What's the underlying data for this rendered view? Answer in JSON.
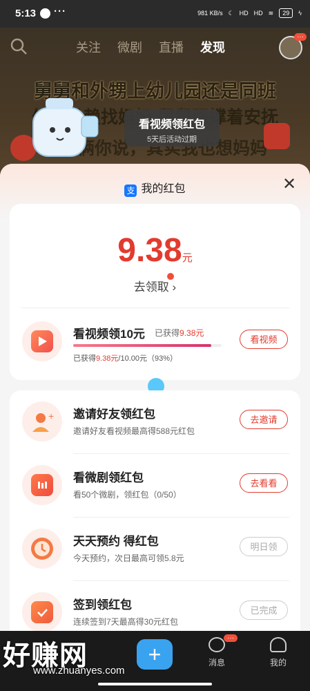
{
  "status": {
    "time": "5:13",
    "dots": "···",
    "speed": "981 KB/s",
    "signal1": "HD",
    "signal2": "HD",
    "battery": "29"
  },
  "nav": {
    "tabs": [
      "关注",
      "微剧",
      "直播",
      "发现"
    ],
    "active": "发现",
    "avatar_badge": "···"
  },
  "video": {
    "title1": "舅舅和外甥上幼儿园还是同班",
    "title2": "外甥没赖找妈妈 舅舅强撑着安抚",
    "title3": "舅舅俩你说，其实我也想妈妈"
  },
  "tooltip": {
    "title": "看视频领红包",
    "subtitle": "5天后活动过期"
  },
  "panel": {
    "header": "我的红包",
    "alipay_icon": "支",
    "amount": "9.38",
    "unit": "元",
    "claim": "去领取 ›",
    "watch_task": {
      "title": "看视频领10元",
      "got_prefix": "已获得",
      "got_value": "9.38元",
      "progress_pct": 93,
      "sub_prefix": "已获得",
      "sub_value": "9.38元",
      "sub_suffix": "/10.00元（93%）",
      "button": "看视频"
    },
    "tasks": [
      {
        "title": "邀请好友领红包",
        "sub": "邀请好友看视频最高得588元红包",
        "button": "去邀请",
        "enabled": true,
        "icon": "invite-friend-icon"
      },
      {
        "title": "看微剧领红包",
        "sub": "看50个微剧，领红包（0/50）",
        "button": "去看看",
        "enabled": true,
        "icon": "tv-icon"
      },
      {
        "title": "天天预约 得红包",
        "sub": "今天预约，次日最高可领5.8元",
        "button": "明日领",
        "enabled": false,
        "icon": "clock-icon"
      },
      {
        "title": "签到领红包",
        "sub": "连续签到7天最高得30元红包",
        "button": "已完成",
        "enabled": false,
        "icon": "calendar-check-icon"
      }
    ]
  },
  "bottom": {
    "plus": "+",
    "messages": "消息",
    "mine": "我的",
    "msg_badge": "···"
  },
  "watermark": {
    "text": "好赚网",
    "url": "www.zhuanyes.com"
  },
  "colors": {
    "accent": "#e23b2e",
    "plus": "#3aa3f0"
  }
}
